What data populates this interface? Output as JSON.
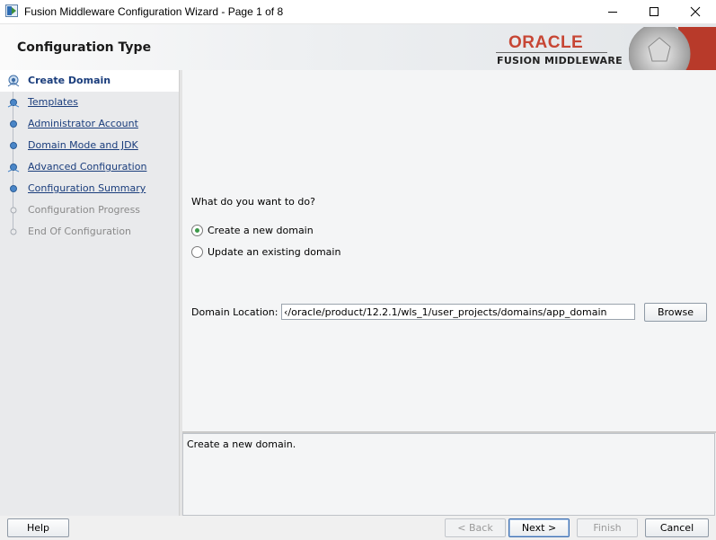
{
  "window": {
    "title": "Fusion Middleware Configuration Wizard - Page 1 of 8",
    "minimize_icon": "minimize-icon",
    "maximize_icon": "maximize-icon",
    "close_icon": "close-icon"
  },
  "header": {
    "page_title": "Configuration Type",
    "logo_oracle": "ORACLE",
    "logo_sub": "FUSION MIDDLEWARE"
  },
  "steps": [
    {
      "label": "Create Domain",
      "state": "active"
    },
    {
      "label": "Templates",
      "state": "link"
    },
    {
      "label": "Administrator Account",
      "state": "link"
    },
    {
      "label": "Domain Mode and JDK",
      "state": "link"
    },
    {
      "label": "Advanced Configuration",
      "state": "link"
    },
    {
      "label": "Configuration Summary",
      "state": "link"
    },
    {
      "label": "Configuration Progress",
      "state": "disabled"
    },
    {
      "label": "End Of Configuration",
      "state": "disabled"
    }
  ],
  "main": {
    "question": "What do you want to do?",
    "options": [
      {
        "label": "Create a new domain",
        "checked": true
      },
      {
        "label": "Update an existing domain",
        "checked": false
      }
    ],
    "domain_location_label": "Domain Location:",
    "domain_location_value": "‹/oracle/product/12.2.1/wls_1/user_projects/domains/app_domain",
    "browse_label": "Browse"
  },
  "description": "Create a new domain.",
  "footer": {
    "help_label": "Help",
    "back_label": "< Back",
    "next_label": "Next >",
    "finish_label": "Finish",
    "cancel_label": "Cancel"
  },
  "colors": {
    "oracle_red": "#c74634",
    "link_blue": "#1a3d7c",
    "radio_green": "#3c9a4a"
  }
}
